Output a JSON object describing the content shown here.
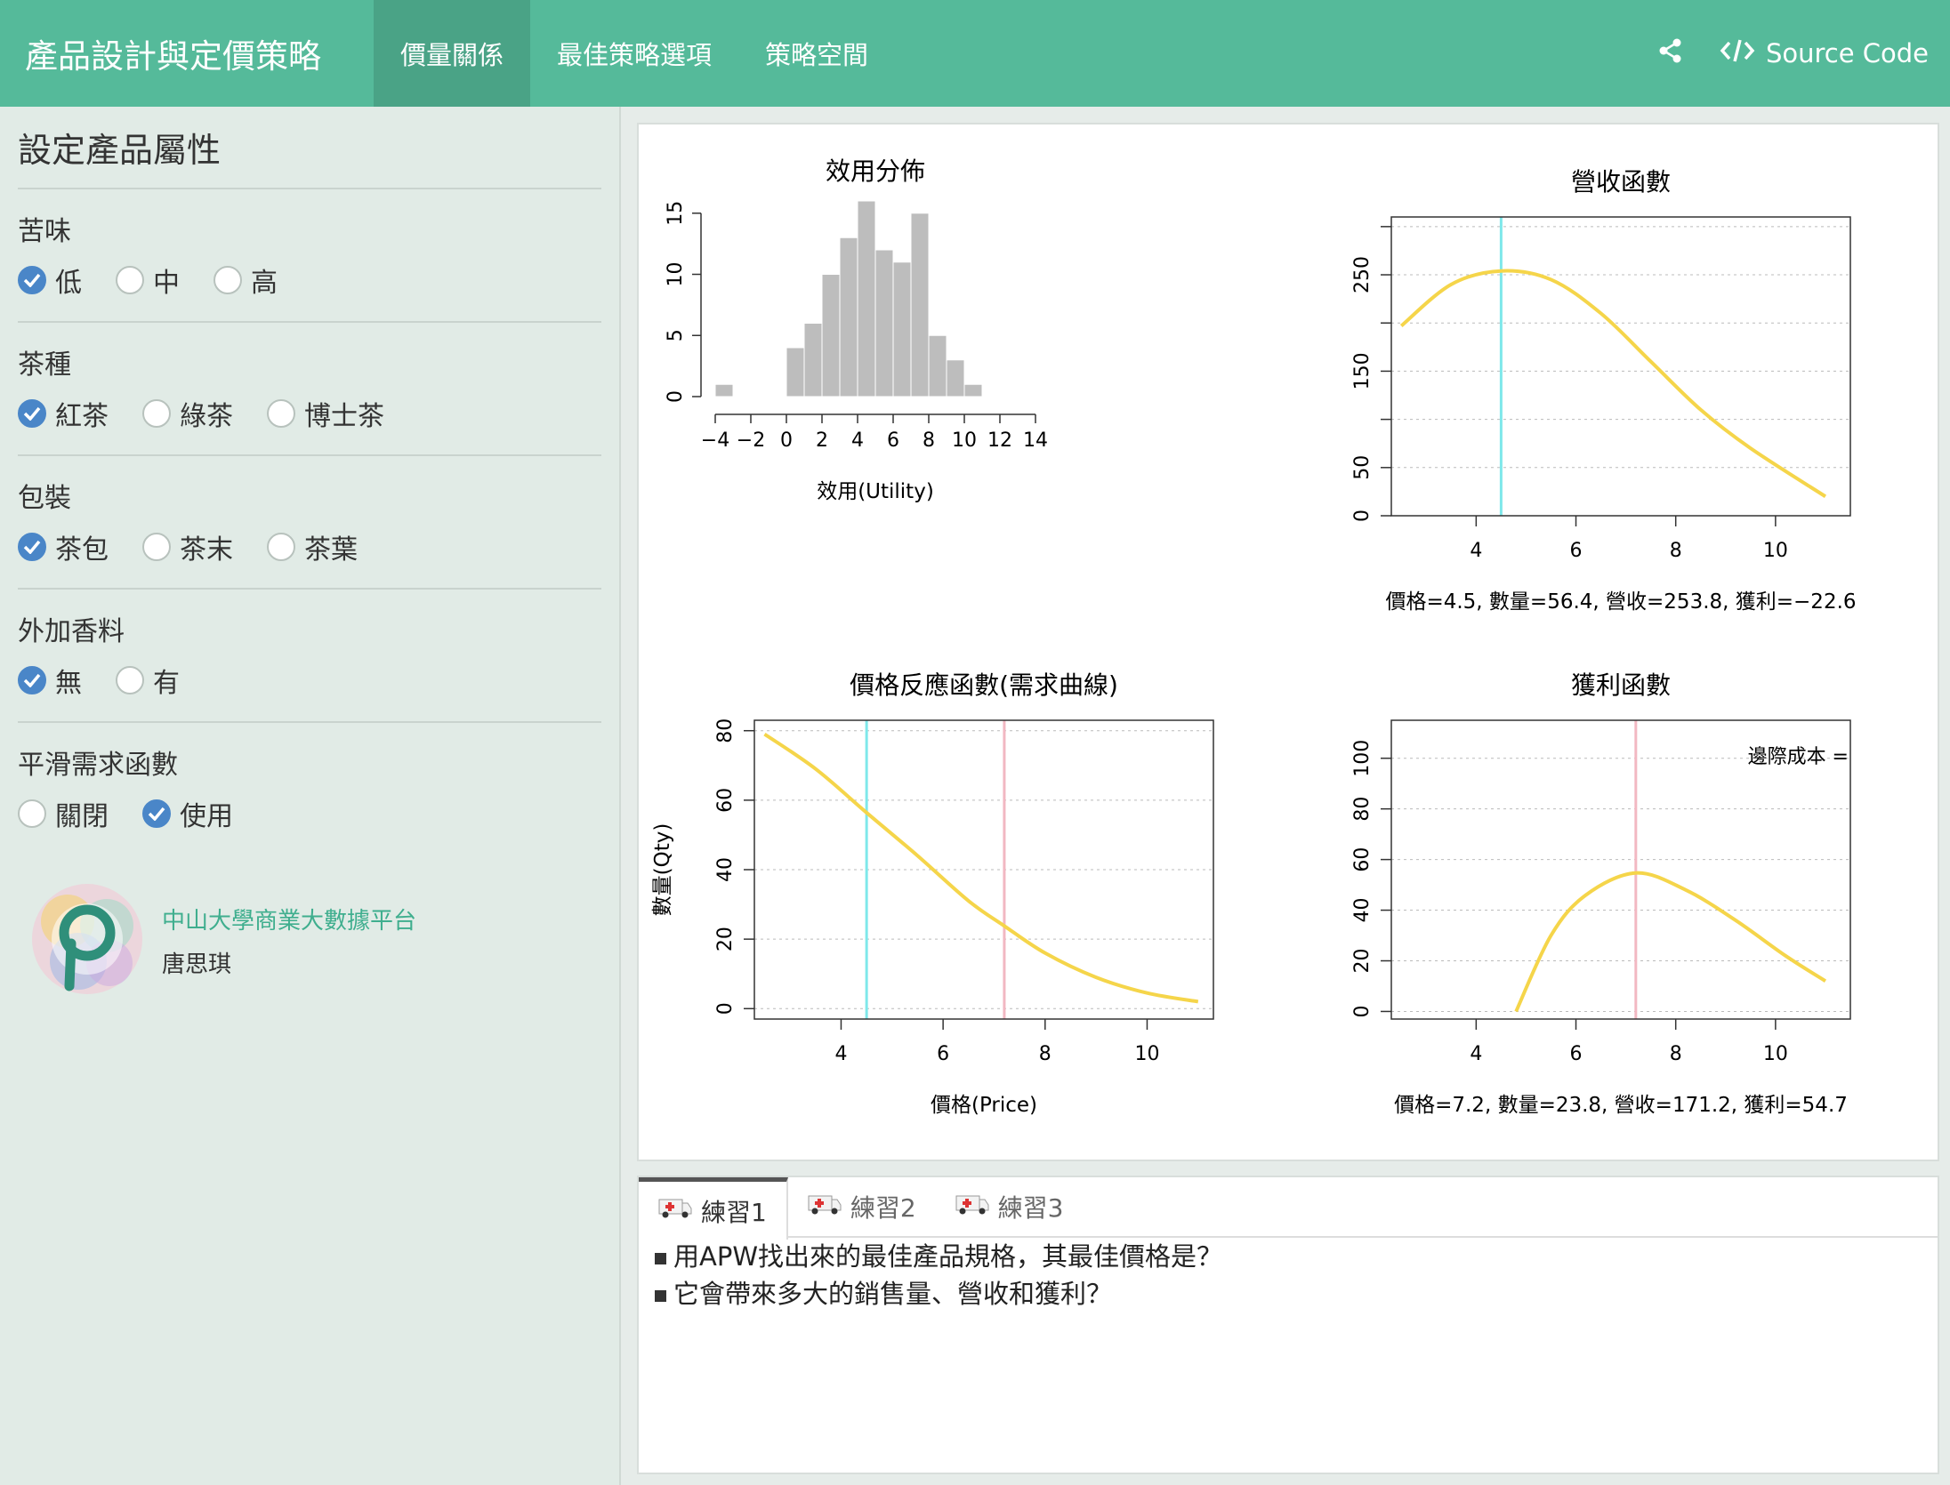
{
  "navbar": {
    "brand": "產品設計與定價策略",
    "tabs": [
      "價量關係",
      "最佳策略選項",
      "策略空間"
    ],
    "source_code": "Source Code"
  },
  "sidebar": {
    "title": "設定產品屬性",
    "groups": [
      {
        "label": "苦味",
        "options": [
          "低",
          "中",
          "高"
        ],
        "selected": "低"
      },
      {
        "label": "茶種",
        "options": [
          "紅茶",
          "綠茶",
          "博士茶"
        ],
        "selected": "紅茶"
      },
      {
        "label": "包裝",
        "options": [
          "茶包",
          "茶末",
          "茶葉"
        ],
        "selected": "茶包"
      },
      {
        "label": "外加香料",
        "options": [
          "無",
          "有"
        ],
        "selected": "無"
      },
      {
        "label": "平滑需求函數",
        "options": [
          "關閉",
          "使用"
        ],
        "selected": "使用"
      }
    ],
    "org": "中山大學商業大數據平台",
    "author": "唐思琪"
  },
  "chart_data": [
    {
      "type": "bar",
      "title": "效用分佈",
      "xlabel": "效用(Utility)",
      "ylabel": "",
      "bins": [
        [
          -4,
          -3
        ],
        [
          0,
          1
        ],
        [
          1,
          2
        ],
        [
          2,
          3
        ],
        [
          3,
          4
        ],
        [
          4,
          5
        ],
        [
          5,
          6
        ],
        [
          6,
          7
        ],
        [
          7,
          8
        ],
        [
          8,
          9
        ],
        [
          9,
          10
        ],
        [
          10,
          11
        ]
      ],
      "values": [
        1,
        4,
        6,
        10,
        13,
        16,
        12,
        11,
        15,
        5,
        3,
        1
      ],
      "xticks": [
        "−4",
        "−2",
        "0",
        "2",
        "4",
        "6",
        "8",
        "10",
        "12",
        "14"
      ],
      "yticks": [
        "0",
        "5",
        "10",
        "15"
      ],
      "xlim": [
        -4,
        14
      ],
      "ylim": [
        0,
        16
      ]
    },
    {
      "type": "line",
      "title": "營收函數",
      "subtitle": "價格=4.5, 數量=56.4, 營收=253.8, 獲利=−22.6",
      "x": [
        2.5,
        3.5,
        4.5,
        5.5,
        6.5,
        7.5,
        8.5,
        9.5,
        11
      ],
      "y": [
        197,
        240,
        254,
        245,
        210,
        160,
        110,
        70,
        20
      ],
      "marker_x": 4.5,
      "xticks": [
        "4",
        "6",
        "8",
        "10"
      ],
      "yticks": [
        "0",
        "50",
        "150",
        "250"
      ],
      "xlim": [
        2.3,
        11.5
      ],
      "ylim": [
        0,
        310
      ]
    },
    {
      "type": "line",
      "title": "價格反應函數(需求曲線)",
      "xlabel": "價格(Price)",
      "ylabel": "數量(Qty)",
      "x": [
        2.5,
        3.5,
        4.5,
        5.5,
        6.5,
        7.2,
        8,
        9,
        10,
        11
      ],
      "y": [
        79,
        69,
        56.4,
        44,
        31,
        23.8,
        16,
        9,
        4.5,
        2
      ],
      "marker_x": [
        4.5,
        7.2
      ],
      "xticks": [
        "4",
        "6",
        "8",
        "10"
      ],
      "yticks": [
        "0",
        "20",
        "40",
        "60",
        "80"
      ],
      "xlim": [
        2.3,
        11.3
      ],
      "ylim": [
        -3,
        83
      ]
    },
    {
      "type": "line",
      "title": "獲利函數",
      "subtitle": "價格=7.2, 數量=23.8, 營收=171.2, 獲利=54.7",
      "annotation": "邊際成本 =",
      "x": [
        4.8,
        5.5,
        6.2,
        7.2,
        8.2,
        9.2,
        10.2,
        11
      ],
      "y": [
        0,
        30,
        46,
        54.7,
        48,
        36,
        22,
        12
      ],
      "marker_x": 7.2,
      "xticks": [
        "4",
        "6",
        "8",
        "10"
      ],
      "yticks": [
        "0",
        "20",
        "40",
        "60",
        "80",
        "100"
      ],
      "xlim": [
        2.3,
        11.5
      ],
      "ylim": [
        -3,
        115
      ]
    }
  ],
  "bottom_tabs": [
    "練習1",
    "練習2",
    "練習3"
  ],
  "questions": [
    "用APW找出來的最佳產品規格，其最佳價格是？",
    "它會帶來多大的銷售量、營收和獲利？"
  ],
  "colors": {
    "nav": "#55ba9a",
    "curve": "#f5d54a",
    "cyan": "#7ee8ea",
    "pink": "#f2b8c2",
    "bar": "#bdbdbd",
    "check": "#4a86c8"
  }
}
